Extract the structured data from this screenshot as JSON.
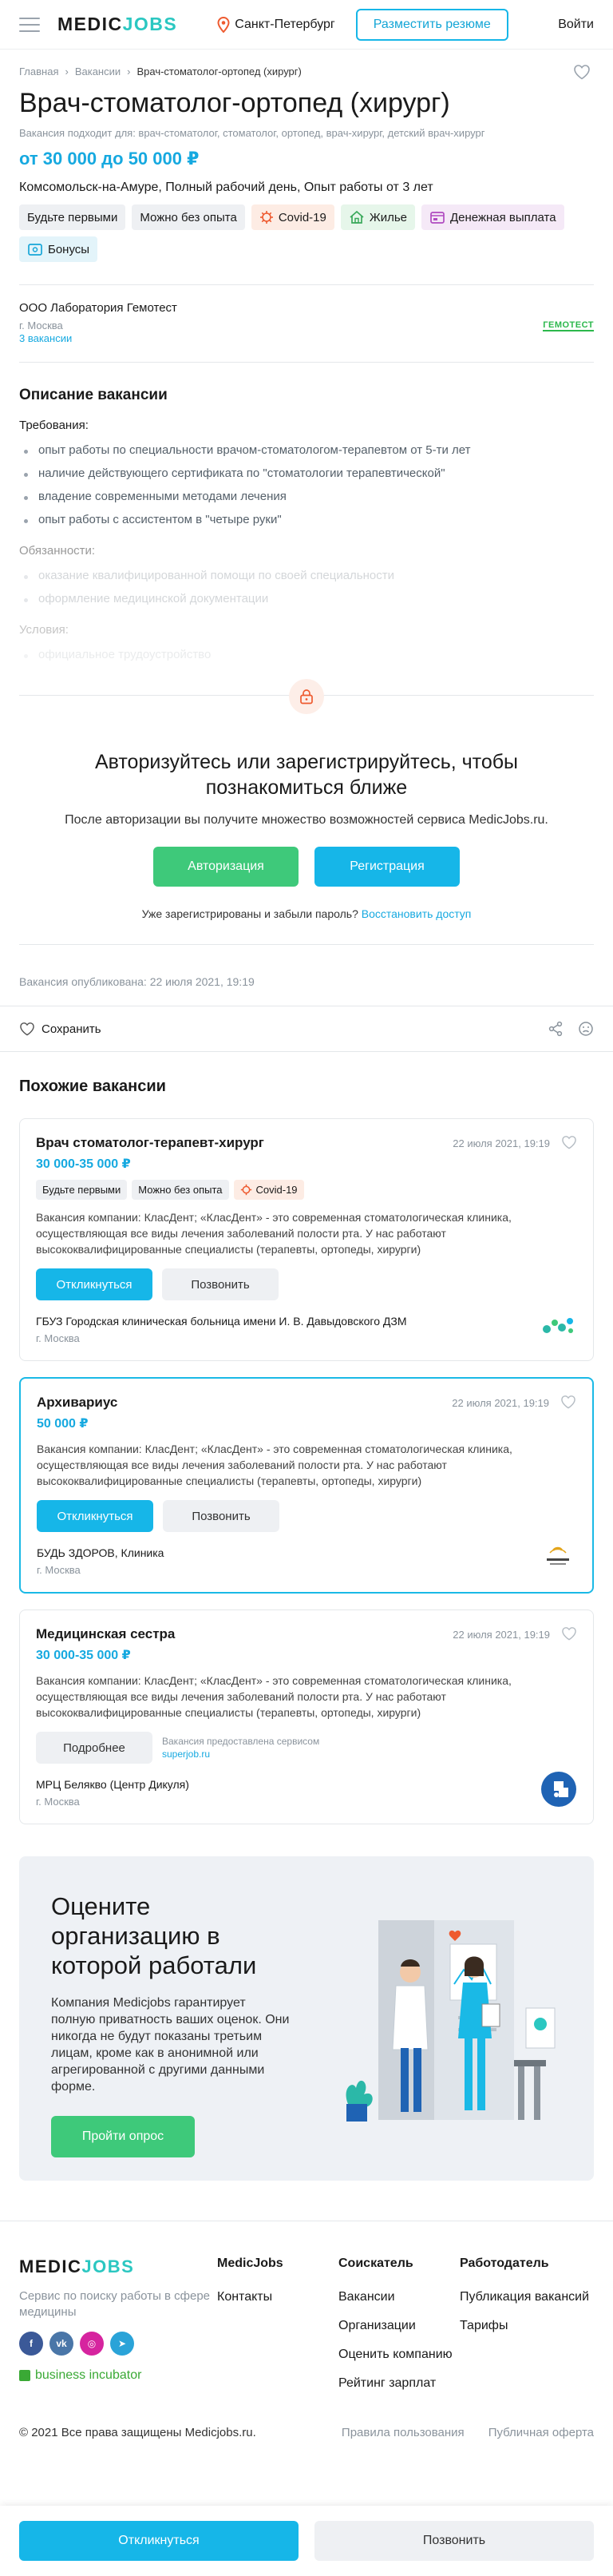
{
  "header": {
    "logo_part1": "MEDIC",
    "logo_part2": "JOBS",
    "city": "Санкт-Петербург",
    "post_resume": "Разместить резюме",
    "login": "Войти"
  },
  "breadcrumbs": [
    "Главная",
    "Вакансии",
    "Врач-стоматолог-ортопед (хирург)"
  ],
  "vacancy": {
    "title": "Врач-стоматолог-ортопед (хирург)",
    "suits": "Вакансия подходит для: врач-стоматолог, стоматолог, ортопед, врач-хирург, детский врач-хирург",
    "salary": "от 30 000 до 50 000 ₽",
    "location": "Комсомольск-на-Амуре, Полный рабочий день, Опыт работы от 3 лет",
    "tags": [
      "Будьте первыми",
      "Можно без опыта",
      "Covid-19",
      "Жилье",
      "Денежная выплата",
      "Бонусы"
    ]
  },
  "company": {
    "name": "ООО Лаборатория Гемотест",
    "city": "г. Москва",
    "count": "3 вакансии",
    "logo_text": "ГЕМОТЕСТ"
  },
  "description": {
    "heading": "Описание вакансии",
    "req_label": "Требования:",
    "requirements": [
      "опыт работы по специальности врачом-стоматологом-терапевтом от 5-ти лет",
      "наличие действующего сертификата по \"стоматологии терапевтической\"",
      "владение современными методами лечения",
      "опыт работы с ассистентом в \"четыре руки\""
    ],
    "duties_label": "Обязанности:",
    "duties": [
      "оказание квалифицированной помощи по своей специальности",
      "оформление медицинской документации"
    ],
    "cond_label": "Условия:",
    "conditions": [
      "официальное трудоустройство"
    ]
  },
  "auth": {
    "heading": "Авторизуйтесь или зарегистрируйтесь, чтобы познакомиться ближе",
    "text": "После авторизации вы получите множество возможностей сервиса MedicJobs.ru.",
    "login_btn": "Авторизация",
    "register_btn": "Регистрация",
    "forgot_text": "Уже зарегистрированы и забыли пароль?",
    "restore_link": "Восстановить доступ"
  },
  "published": "Вакансия опубликована: 22 июля 2021, 19:19",
  "actions": {
    "save": "Сохранить"
  },
  "similar": {
    "heading": "Похожие вакансии",
    "cards": [
      {
        "title": "Врач стоматолог-терапевт-хирург",
        "date": "22 июля 2021, 19:19",
        "salary": "30 000-35 000 ₽",
        "tags": [
          "Будьте первыми",
          "Можно без опыта",
          "Covid-19"
        ],
        "desc": "Вакансия компании: КласДент; «КласДент» - это современная стоматологическая клиника, осуществляющая все виды лечения заболеваний полости рта. У нас работают высококвалифицированные специалисты (терапевты, ортопеды, хирурги)",
        "btn1": "Откликнуться",
        "btn2": "Позвонить",
        "org": "ГБУЗ Городская клиническая больница имени И. В. Давыдовского ДЗМ",
        "city": "г. Москва"
      },
      {
        "title": "Архивариус",
        "date": "22 июля 2021, 19:19",
        "salary": "50 000 ₽",
        "desc": "Вакансия компании: КласДент; «КласДент» - это современная стоматологическая клиника, осуществляющая все виды лечения заболеваний полости рта. У нас работают высококвалифицированные специалисты (терапевты, ортопеды, хирурги)",
        "btn1": "Откликнуться",
        "btn2": "Позвонить",
        "org": "БУДЬ ЗДОРОВ, Клиника",
        "city": "г. Москва"
      },
      {
        "title": "Медицинская сестра",
        "date": "22 июля 2021, 19:19",
        "salary": "30 000-35 000 ₽",
        "desc": "Вакансия компании: КласДент; «КласДент» - это современная стоматологическая клиника, осуществляющая все виды лечения заболеваний полости рта. У нас работают высококвалифицированные специалисты (терапевты, ортопеды, хирурги)",
        "btn1": "Подробнее",
        "src_text": "Вакансия предоставлена сервисом",
        "src_link": "superjob.ru",
        "org": "МРЦ Белякво (Центр Дикуля)",
        "city": "г. Москва"
      }
    ]
  },
  "promo": {
    "heading": "Оцените организацию в которой работали",
    "text": "Компания Medicjobs гарантирует полную приватность ваших оценок. Они никогда не будут показаны третьим лицам, кроме как в анонимной или агрегированной с другими данными форме.",
    "btn": "Пройти опрос"
  },
  "footer": {
    "tagline": "Сервис по поиску работы в сфере медицины",
    "business": "business incubator",
    "cols": [
      {
        "title": "MedicJobs",
        "links": [
          "Контакты"
        ]
      },
      {
        "title": "Соискатель",
        "links": [
          "Вакансии",
          "Организации",
          "Оценить компанию",
          "Рейтинг зарплат"
        ]
      },
      {
        "title": "Работодатель",
        "links": [
          "Публикация вакансий",
          "Тарифы"
        ]
      }
    ],
    "copyright": "© 2021 Все права защищены Medicjobs.ru.",
    "privacy": "Правила пользования",
    "offer": "Публичная оферта"
  },
  "sticky": {
    "respond": "Откликнуться",
    "call": "Позвонить"
  },
  "colors": {
    "accent": "#16b6e8",
    "green": "#3ec97a",
    "teal": "#2bc7c1"
  }
}
